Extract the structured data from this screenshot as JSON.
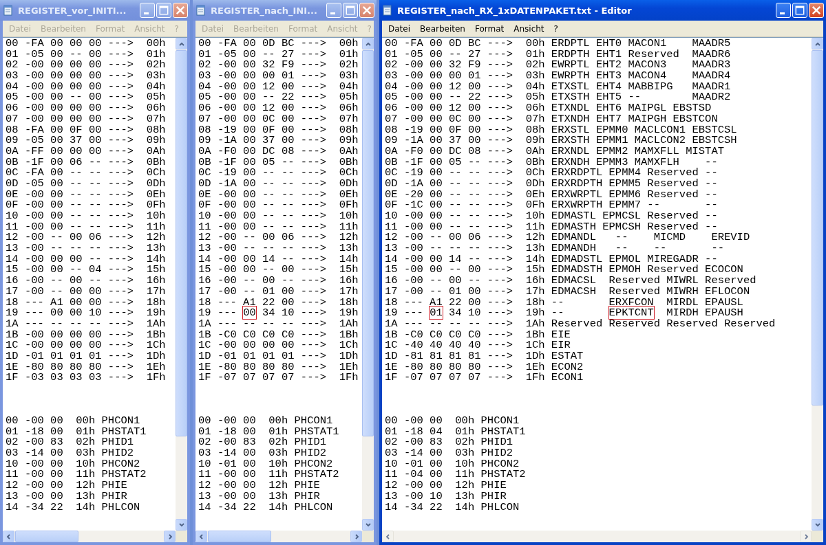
{
  "windows": [
    {
      "title": "REGISTER_vor_INITI...",
      "active": false,
      "menu": [
        {
          "label": "Datei"
        },
        {
          "label": "Bearbeiten"
        },
        {
          "label": "Format"
        },
        {
          "label": "Ansicht"
        },
        {
          "label": "?"
        }
      ],
      "registers": [
        {
          "text": "00 -FA 00 00 00 --->  00h"
        },
        {
          "text": "01 -05 00 -- 00 --->  01h"
        },
        {
          "text": "02 -00 00 00 00 --->  02h"
        },
        {
          "text": "03 -00 00 00 00 --->  03h"
        },
        {
          "text": "04 -00 00 00 00 --->  04h"
        },
        {
          "text": "05 -00 00 -- 00 --->  05h"
        },
        {
          "text": "06 -00 00 00 00 --->  06h"
        },
        {
          "text": "07 -00 00 00 00 --->  07h"
        },
        {
          "text": "08 -FA 00 0F 00 --->  08h"
        },
        {
          "text": "09 -05 00 37 00 --->  09h"
        },
        {
          "text": "0A -FF 00 00 00 --->  0Ah"
        },
        {
          "text": "0B -1F 00 06 -- --->  0Bh"
        },
        {
          "text": "0C -FA 00 -- -- --->  0Ch"
        },
        {
          "text": "0D -05 00 -- -- --->  0Dh"
        },
        {
          "text": "0E -00 00 -- -- --->  0Eh"
        },
        {
          "text": "0F -00 00 -- -- --->  0Fh"
        },
        {
          "text": "10 -00 00 -- -- --->  10h"
        },
        {
          "text": "11 -00 00 -- -- --->  11h"
        },
        {
          "text": "12 -00 -- 00 06 --->  12h"
        },
        {
          "text": "13 -00 -- -- -- --->  13h"
        },
        {
          "text": "14 -00 00 00 -- --->  14h"
        },
        {
          "text": "15 -00 00 -- 04 --->  15h"
        },
        {
          "text": "16 -00 -- 00 -- --->  16h"
        },
        {
          "text": "17 -00 -- 00 00 --->  17h"
        },
        {
          "text": "18 --- A1 00 00 --->  18h"
        },
        {
          "text": "19 --- 00 00 10 --->  19h"
        },
        {
          "text": "1A --- -- -- -- --->  1Ah"
        },
        {
          "text": "1B -00 00 00 00 --->  1Bh"
        },
        {
          "text": "1C -00 00 00 00 --->  1Ch"
        },
        {
          "text": "1D -01 01 01 01 --->  1Dh"
        },
        {
          "text": "1E -80 80 80 80 --->  1Eh"
        },
        {
          "text": "1F -03 03 03 03 --->  1Fh"
        }
      ],
      "phy_registers": [
        {
          "text": "00 -00 00  00h PHCON1"
        },
        {
          "text": "01 -18 00  01h PHSTAT1"
        },
        {
          "text": "02 -00 83  02h PHID1"
        },
        {
          "text": "03 -14 00  03h PHID2"
        },
        {
          "text": "10 -00 00  10h PHCON2"
        },
        {
          "text": "11 -00 00  11h PHSTAT2"
        },
        {
          "text": "12 -00 00  12h PHIE"
        },
        {
          "text": "13 -00 00  13h PHIR"
        },
        {
          "text": "14 -34 22  14h PHLCON"
        }
      ]
    },
    {
      "title": "REGISTER_nach_INI...",
      "active": false,
      "menu": [
        {
          "label": "Datei"
        },
        {
          "label": "Bearbeiten"
        },
        {
          "label": "Format"
        },
        {
          "label": "Ansicht"
        },
        {
          "label": "?"
        }
      ],
      "registers": [
        {
          "text": "00 -FA 00 0D BC --->  00h"
        },
        {
          "text": "01 -05 00 -- 27 --->  01h"
        },
        {
          "text": "02 -00 00 32 F9 --->  02h"
        },
        {
          "text": "03 -00 00 00 01 --->  03h"
        },
        {
          "text": "04 -00 00 12 00 --->  04h"
        },
        {
          "text": "05 -00 00 -- 22 --->  05h"
        },
        {
          "text": "06 -00 00 12 00 --->  06h"
        },
        {
          "text": "07 -00 00 0C 00 --->  07h"
        },
        {
          "text": "08 -19 00 0F 00 --->  08h"
        },
        {
          "text": "09 -1A 00 37 00 --->  09h"
        },
        {
          "text": "0A -F0 00 DC 08 --->  0Ah"
        },
        {
          "text": "0B -1F 00 05 -- --->  0Bh"
        },
        {
          "text": "0C -19 00 -- -- --->  0Ch"
        },
        {
          "text": "0D -1A 00 -- -- --->  0Dh"
        },
        {
          "text": "0E -00 00 -- -- --->  0Eh"
        },
        {
          "text": "0F -00 00 -- -- --->  0Fh"
        },
        {
          "text": "10 -00 00 -- -- --->  10h"
        },
        {
          "text": "11 -00 00 -- -- --->  11h"
        },
        {
          "text": "12 -00 -- 00 06 --->  12h"
        },
        {
          "text": "13 -00 -- -- -- --->  13h"
        },
        {
          "text": "14 -00 00 14 -- --->  14h"
        },
        {
          "text": "15 -00 00 -- 00 --->  15h"
        },
        {
          "text": "16 -00 -- 00 -- --->  16h"
        },
        {
          "text": "17 -00 -- 01 00 --->  17h"
        },
        {
          "text": "18 --- A1 22 00 --->  18h"
        },
        {
          "parts": [
            {
              "text": "19 --- ",
              "boxed": false
            },
            {
              "text": "00",
              "boxed": true
            },
            {
              "text": " 34 10 --->  19h",
              "boxed": false
            }
          ]
        },
        {
          "text": "1A --- -- -- -- --->  1Ah"
        },
        {
          "text": "1B -C0 C0 C0 C0 --->  1Bh"
        },
        {
          "text": "1C -00 00 00 00 --->  1Ch"
        },
        {
          "text": "1D -01 01 01 01 --->  1Dh"
        },
        {
          "text": "1E -80 80 80 80 --->  1Eh"
        },
        {
          "text": "1F -07 07 07 07 --->  1Fh"
        }
      ],
      "phy_registers": [
        {
          "text": "00 -00 00  00h PHCON1"
        },
        {
          "text": "01 -18 00  01h PHSTAT1"
        },
        {
          "text": "02 -00 83  02h PHID1"
        },
        {
          "text": "03 -14 00  03h PHID2"
        },
        {
          "text": "10 -01 00  10h PHCON2"
        },
        {
          "text": "11 -00 00  11h PHSTAT2"
        },
        {
          "text": "12 -00 00  12h PHIE"
        },
        {
          "text": "13 -00 00  13h PHIR"
        },
        {
          "text": "14 -34 22  14h PHLCON"
        }
      ]
    },
    {
      "title": "REGISTER_nach_RX_1xDATENPAKET.txt - Editor",
      "active": true,
      "menu": [
        {
          "label": "Datei"
        },
        {
          "label": "Bearbeiten"
        },
        {
          "label": "Format"
        },
        {
          "label": "Ansicht"
        },
        {
          "label": "?"
        }
      ],
      "registers": [
        {
          "text": "00 -FA 00 0D BC --->  00h ERDPTL EHT0 MACON1    MAADR5"
        },
        {
          "text": "01 -05 00 -- 27 --->  01h ERDPTH EHT1 Reserved  MAADR6"
        },
        {
          "text": "02 -00 00 32 F9 --->  02h EWRPTL EHT2 MACON3    MAADR3"
        },
        {
          "text": "03 -00 00 00 01 --->  03h EWRPTH EHT3 MACON4    MAADR4"
        },
        {
          "text": "04 -00 00 12 00 --->  04h ETXSTL EHT4 MABBIPG   MAADR1"
        },
        {
          "text": "05 -00 00 -- 22 --->  05h ETXSTH EHT5 --        MAADR2"
        },
        {
          "text": "06 -00 00 12 00 --->  06h ETXNDL EHT6 MAIPGL EBSTSD"
        },
        {
          "text": "07 -00 00 0C 00 --->  07h ETXNDH EHT7 MAIPGH EBSTCON"
        },
        {
          "text": "08 -19 00 0F 00 --->  08h ERXSTL EPMM0 MACLCON1 EBSTCSL"
        },
        {
          "text": "09 -1A 00 37 00 --->  09h ERXSTH EPMM1 MACLCON2 EBSTCSH"
        },
        {
          "text": "0A -F0 00 DC 08 --->  0Ah ERXNDL EPMM2 MAMXFLL MISTAT"
        },
        {
          "text": "0B -1F 00 05 -- --->  0Bh ERXNDH EPMM3 MAMXFLH    --"
        },
        {
          "text": "0C -19 00 -- -- --->  0Ch ERXRDPTL EPMM4 Reserved --"
        },
        {
          "text": "0D -1A 00 -- -- --->  0Dh ERXRDPTH EPMM5 Reserved --"
        },
        {
          "text": "0E -20 00 -- -- --->  0Eh ERXWRPTL EPMM6 Reserved --"
        },
        {
          "text": "0F -1C 00 -- -- --->  0Fh ERXWRPTH EPMM7 --       --"
        },
        {
          "text": "10 -00 00 -- -- --->  10h EDMASTL EPMCSL Reserved --"
        },
        {
          "text": "11 -00 00 -- -- --->  11h EDMASTH EPMCSH Reserved --"
        },
        {
          "text": "12 -00 -- 00 06 --->  12h EDMANDL   --    MICMD    EREVID"
        },
        {
          "text": "13 -00 -- -- -- --->  13h EDMANDH   --    --       --"
        },
        {
          "text": "14 -00 00 14 -- --->  14h EDMADSTL EPMOL MIREGADR --"
        },
        {
          "text": "15 -00 00 -- 00 --->  15h EDMADSTH EPMOH Reserved ECOCON"
        },
        {
          "text": "16 -00 -- 00 -- --->  16h EDMACSL  Reserved MIWRL Reserved"
        },
        {
          "text": "17 -00 -- 01 00 --->  17h EDMACSH  Reserved MIWRH EFLOCON"
        },
        {
          "text": "18 --- A1 22 00 --->  18h --       ERXFCON  MIRDL EPAUSL"
        },
        {
          "parts": [
            {
              "text": "19 --- ",
              "boxed": false
            },
            {
              "text": "01",
              "boxed": true
            },
            {
              "text": " 34 10 --->  19h --       ",
              "boxed": false
            },
            {
              "text": "EPKTCNT",
              "boxed": true
            },
            {
              "text": "  MIRDH EPAUSH",
              "boxed": false
            }
          ]
        },
        {
          "text": "1A --- -- -- -- --->  1Ah Reserved Reserved Reserved Reserved"
        },
        {
          "text": "1B -C0 C0 C0 C0 --->  1Bh EIE"
        },
        {
          "text": "1C -40 40 40 40 --->  1Ch EIR"
        },
        {
          "text": "1D -81 81 81 81 --->  1Dh ESTAT"
        },
        {
          "text": "1E -80 80 80 80 --->  1Eh ECON2"
        },
        {
          "text": "1F -07 07 07 07 --->  1Fh ECON1"
        }
      ],
      "phy_registers": [
        {
          "text": "00 -00 00  00h PHCON1"
        },
        {
          "text": "01 -18 04  01h PHSTAT1"
        },
        {
          "text": "02 -00 83  02h PHID1"
        },
        {
          "text": "03 -14 00  03h PHID2"
        },
        {
          "text": "10 -01 00  10h PHCON2"
        },
        {
          "text": "11 -04 00  11h PHSTAT2"
        },
        {
          "text": "12 -00 00  12h PHIE"
        },
        {
          "text": "13 -00 10  13h PHIR"
        },
        {
          "text": "14 -34 22  14h PHLCON"
        }
      ]
    }
  ]
}
